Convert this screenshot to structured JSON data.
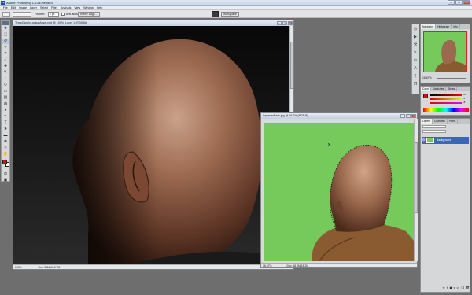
{
  "window": {
    "title": "Adobe Photoshop CS3 Extended",
    "logo": "Ps"
  },
  "menu": [
    "File",
    "Edit",
    "Image",
    "Layer",
    "Select",
    "Filter",
    "Analysis",
    "View",
    "Window",
    "Help"
  ],
  "options": {
    "feather_label": "Feather:",
    "feather_value": "0 px",
    "antialias_label": "Anti-alias",
    "refine_edge_label": "Refine Edge...",
    "workspace_label": "Workspace"
  },
  "doc1": {
    "title": "Temp2ApplyLockupAsset.psd @ 100% (Layer 1, RGB/8#)",
    "zoom": "100%",
    "doc_size": "Doc: 2.84M/10.7M"
  },
  "doc2": {
    "title": "SquarterBack.jpg @ 16.7% (RGB/8)",
    "zoom": "16.67%",
    "doc_size": "Doc: 18.2M/18.2M"
  },
  "navigator": {
    "tabs": [
      "Navigator",
      "Histogram",
      "Info"
    ],
    "zoom": "16.67%"
  },
  "color_panel": {
    "tabs": [
      "Color",
      "Swatches",
      "Styles"
    ],
    "fg_color": "#d10f12",
    "channel_values": [
      "209",
      "15",
      "18"
    ]
  },
  "layers_panel": {
    "tabs": [
      "Layers",
      "Channels",
      "Paths"
    ],
    "layer_name": "Background"
  },
  "colors": {
    "title_bg": "#c9d8ea",
    "canvas_dark": "#0c0c0c",
    "green_screen": "#76c95b",
    "skin": "#9a6a4e",
    "jacket": "#8a5a30"
  }
}
